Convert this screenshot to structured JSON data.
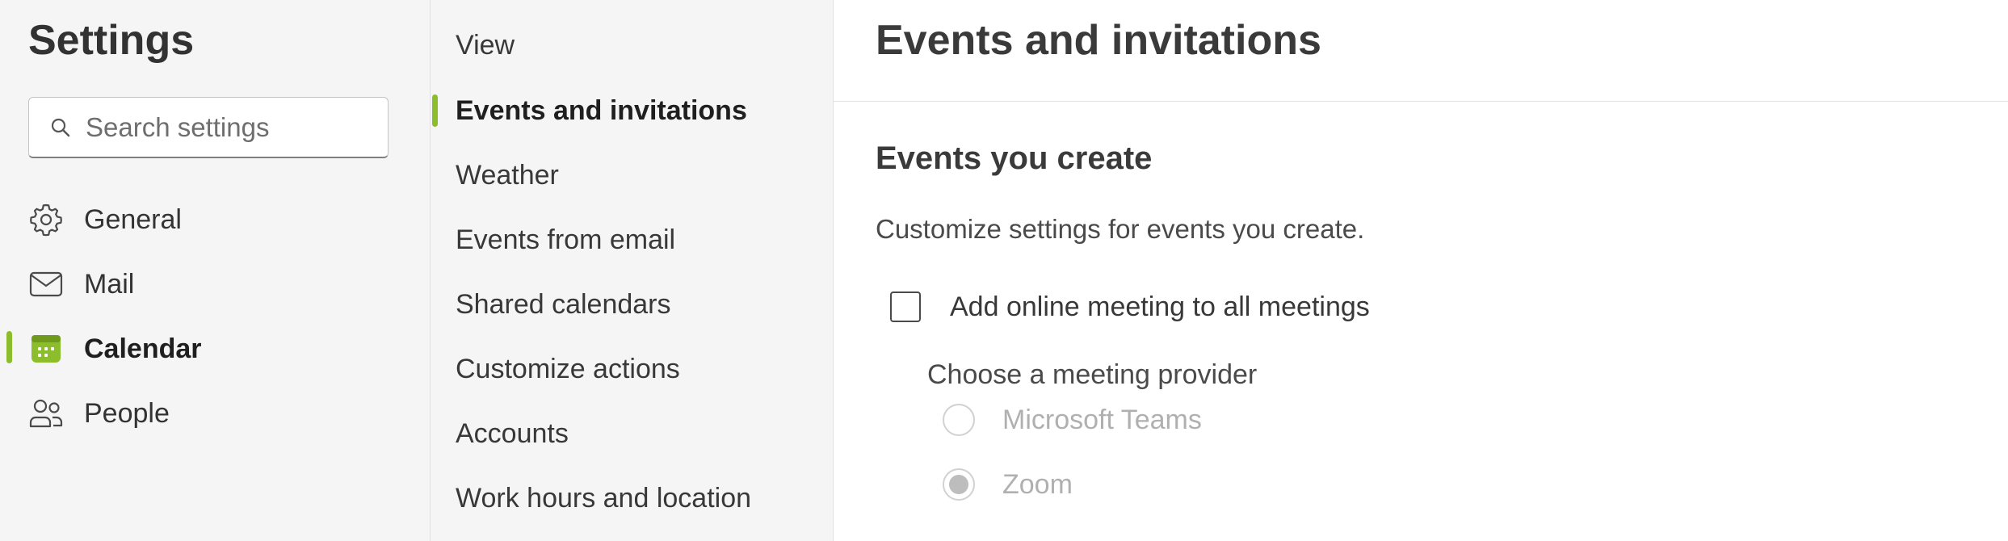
{
  "settings_title": "Settings",
  "search": {
    "placeholder": "Search settings",
    "icon": "search-icon"
  },
  "nav": {
    "items": [
      {
        "label": "General",
        "icon": "gear-icon",
        "active": false
      },
      {
        "label": "Mail",
        "icon": "mail-icon",
        "active": false
      },
      {
        "label": "Calendar",
        "icon": "calendar-icon",
        "active": true
      },
      {
        "label": "People",
        "icon": "people-icon",
        "active": false
      }
    ]
  },
  "subnav": {
    "items": [
      {
        "label": "View",
        "active": false
      },
      {
        "label": "Events and invitations",
        "active": true
      },
      {
        "label": "Weather",
        "active": false
      },
      {
        "label": "Events from email",
        "active": false
      },
      {
        "label": "Shared calendars",
        "active": false
      },
      {
        "label": "Customize actions",
        "active": false
      },
      {
        "label": "Accounts",
        "active": false
      },
      {
        "label": "Work hours and location",
        "active": false
      }
    ]
  },
  "content": {
    "page_title": "Events and invitations",
    "section_title": "Events you create",
    "section_desc": "Customize settings for events you create.",
    "online_meeting_checkbox": {
      "label": "Add online meeting to all meetings",
      "checked": false
    },
    "provider_label": "Choose a meeting provider",
    "providers": [
      {
        "label": "Microsoft Teams",
        "selected": false,
        "disabled": true
      },
      {
        "label": "Zoom",
        "selected": true,
        "disabled": true
      }
    ]
  },
  "colors": {
    "accent": "#8cbd2c",
    "nav_background": "#f5f5f5",
    "content_background": "#ffffff",
    "disabled_text": "#b0b0b0"
  }
}
